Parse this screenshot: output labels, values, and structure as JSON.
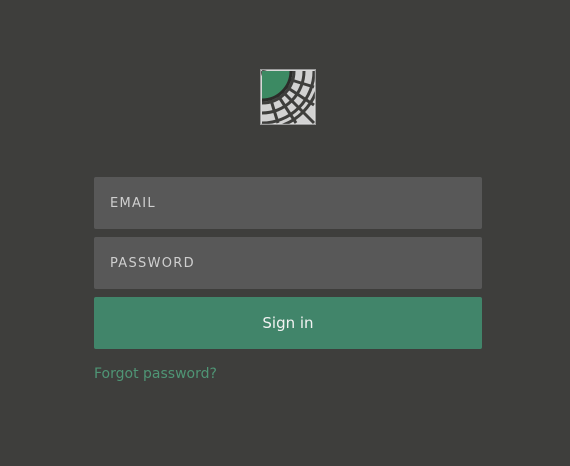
{
  "logo": {
    "icon": "web-grid-logo-icon",
    "accent": "#3c8a63",
    "frame": "#a9a9a9"
  },
  "login": {
    "email_placeholder": "EMAIL",
    "password_placeholder": "PASSWORD",
    "signin_label": "Sign in",
    "forgot_label": "Forgot password?"
  },
  "colors": {
    "background": "#3e3e3c",
    "field": "#585858",
    "primary": "#41856a",
    "link": "#4f9575"
  }
}
